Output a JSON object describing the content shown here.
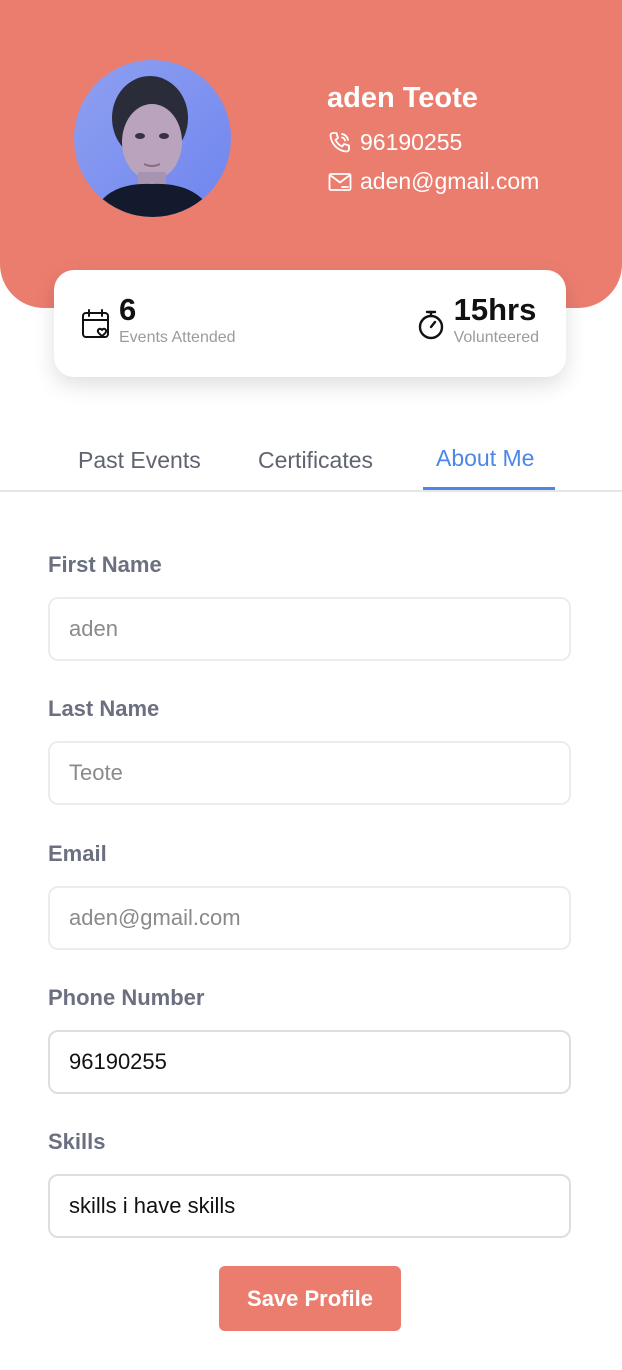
{
  "profile": {
    "name": "aden Teote",
    "phone": "96190255",
    "email": "aden@gmail.com",
    "avatar_icon": "profile-photo",
    "accent_color": "#EB7D6F"
  },
  "stats": {
    "events": {
      "value": "6",
      "label": "Events Attended",
      "icon": "calendar-heart-icon"
    },
    "hours": {
      "value": "15hrs",
      "label": "Volunteered",
      "icon": "stopwatch-icon"
    }
  },
  "tabs": [
    {
      "label": "Past Events",
      "active": false
    },
    {
      "label": "Certificates",
      "active": false
    },
    {
      "label": "About Me",
      "active": true
    }
  ],
  "active_tab_color": "#4A87E8",
  "form": {
    "first_name": {
      "label": "First Name",
      "placeholder": "aden",
      "value": ""
    },
    "last_name": {
      "label": "Last Name",
      "placeholder": "Teote",
      "value": ""
    },
    "email": {
      "label": "Email",
      "placeholder": "aden@gmail.com",
      "value": ""
    },
    "phone": {
      "label": "Phone Number",
      "placeholder": "",
      "value": "96190255"
    },
    "skills": {
      "label": "Skills",
      "placeholder": "",
      "value": "skills i have skills"
    }
  },
  "save_label": "Save Profile"
}
